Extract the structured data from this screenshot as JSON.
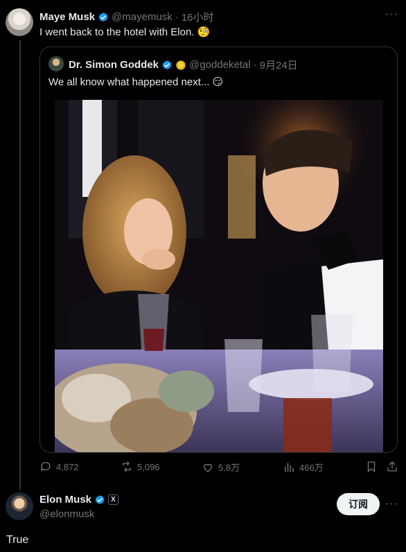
{
  "parent_tweet": {
    "author_name": "Maye Musk",
    "handle": "@mayemusk",
    "separator": "·",
    "time": "16小时",
    "text": "I went back to the hotel with Elon.",
    "emoji": "🧐"
  },
  "quoted_tweet": {
    "author_name": "Dr. Simon Goddek",
    "handle": "@goddeketal",
    "separator": "·",
    "date": "9月24日",
    "text": "We all know what happened next...",
    "emoji": "😏"
  },
  "actions": {
    "reply_count": "4,872",
    "retweet_count": "5,096",
    "like_count": "5.8万",
    "views_count": "466万"
  },
  "reply": {
    "author_name": "Elon Musk",
    "handle": "@elonmusk",
    "x_badge": "X",
    "text": "True",
    "subscribe_label": "订阅"
  },
  "colors": {
    "verified_blue": "#1d9bf0",
    "gold_badge": "#e2b719",
    "muted": "#71767b"
  }
}
